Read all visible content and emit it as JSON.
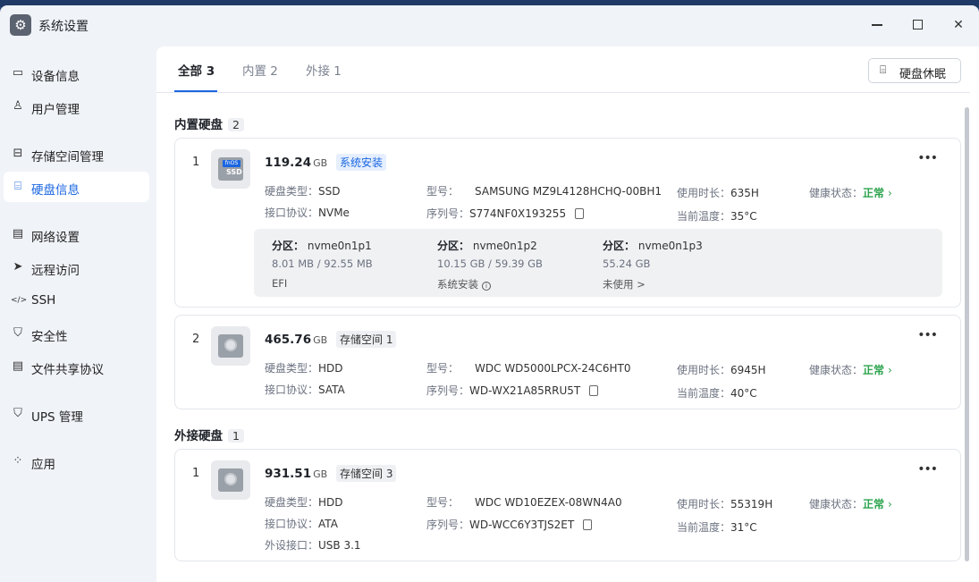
{
  "window": {
    "title": "系统设置",
    "app_icon": "gear-icon"
  },
  "sidebar": {
    "items": [
      {
        "label": "设备信息",
        "icon": "device-icon"
      },
      {
        "label": "用户管理",
        "icon": "user-icon"
      },
      {
        "label": "存储空间管理",
        "icon": "storage-icon"
      },
      {
        "label": "硬盘信息",
        "icon": "disk-icon"
      },
      {
        "label": "网络设置",
        "icon": "network-icon"
      },
      {
        "label": "远程访问",
        "icon": "remote-icon"
      },
      {
        "label": "SSH",
        "icon": "ssh-icon"
      },
      {
        "label": "安全性",
        "icon": "shield-icon"
      },
      {
        "label": "文件共享协议",
        "icon": "file-share-icon"
      },
      {
        "label": "UPS 管理",
        "icon": "ups-icon"
      },
      {
        "label": "应用",
        "icon": "apps-icon"
      }
    ]
  },
  "tabs": [
    {
      "label": "全部 3",
      "active": true
    },
    {
      "label": "内置 2",
      "active": false
    },
    {
      "label": "外接 1",
      "active": false
    }
  ],
  "sleep_button": "硬盘休眠",
  "sections": {
    "internal": {
      "title": "内置硬盘",
      "count": "2"
    },
    "external": {
      "title": "外接硬盘",
      "count": "1"
    }
  },
  "labels": {
    "disk_type": "硬盘类型：",
    "interface": "接口协议：",
    "model": "型号：",
    "serial": "序列号：",
    "usage_time": "使用时长：",
    "temperature": "当前温度：",
    "health": "健康状态：",
    "external_port": "外设接口：",
    "partition": "分区："
  },
  "disks": [
    {
      "index": "1",
      "size": "119.24",
      "unit": "GB",
      "badge": "系统安装",
      "badge_color": "#1a66e0",
      "disk_type": "SSD",
      "interface": "NVMe",
      "model": "SAMSUNG MZ9L4128HCHQ-00BH1",
      "serial": "S774NF0X193255",
      "usage_time": "635H",
      "temperature": "35°C",
      "health": "正常",
      "icon_tag": "fnOS",
      "icon_text": "SSD",
      "partitions": [
        {
          "name": "nvme0n1p1",
          "usage": "8.01 MB / 92.55 MB",
          "role": "EFI"
        },
        {
          "name": "nvme0n1p2",
          "usage": "10.15 GB / 59.39 GB",
          "role": "系统安装"
        },
        {
          "name": "nvme0n1p3",
          "usage": "55.24 GB",
          "role": "未使用 >"
        }
      ]
    },
    {
      "index": "2",
      "size": "465.76",
      "unit": "GB",
      "badge": "存储空间 1",
      "disk_type": "HDD",
      "interface": "SATA",
      "model": "WDC WD5000LPCX-24C6HT0",
      "serial": "WD-WX21A85RRU5T",
      "usage_time": "6945H",
      "temperature": "40°C",
      "health": "正常"
    },
    {
      "index": "1",
      "size": "931.51",
      "unit": "GB",
      "badge": "存储空间 3",
      "disk_type": "HDD",
      "interface": "ATA",
      "model": "WDC WD10EZEX-08WN4A0",
      "serial": "WD-WCC6Y3TJS2ET",
      "usage_time": "55319H",
      "temperature": "31°C",
      "health": "正常",
      "external_port": "USB 3.1"
    }
  ],
  "colors": {
    "accent": "#1a66e0",
    "healthy": "#2da44e"
  }
}
